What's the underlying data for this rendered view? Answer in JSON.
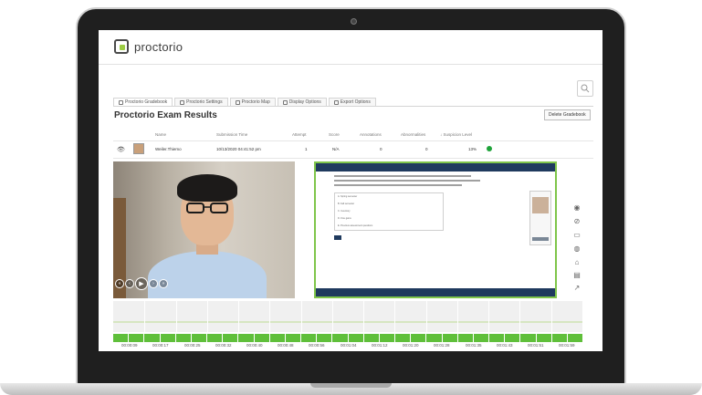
{
  "app": {
    "logo_text": "proctorio"
  },
  "tabs": [
    {
      "label": "Proctorio Gradebook",
      "icon": "gradebook-icon",
      "active": true
    },
    {
      "label": "Proctorio Settings",
      "icon": "gear-icon",
      "active": false
    },
    {
      "label": "Proctorio Map",
      "icon": "map-icon",
      "active": false
    },
    {
      "label": "Display Options",
      "icon": "display-icon",
      "active": false
    },
    {
      "label": "Export Options",
      "icon": "export-icon",
      "active": false
    }
  ],
  "page": {
    "title": "Proctorio Exam Results",
    "delete_button": "Delete Gradebook"
  },
  "table": {
    "headers": [
      "Name",
      "Submission Time",
      "Attempt",
      "Score",
      "Annotations",
      "Abnormalities",
      "Suspicion Level"
    ],
    "row": {
      "name": "Weiler.Thiemo",
      "submission_time": "10/13/2020 04:41:52 pm",
      "attempt": "1",
      "score": "N/A",
      "annotations": "0",
      "abnormalities": "0",
      "suspicion": "13%",
      "suspicion_color": "#1fa33a"
    }
  },
  "capture": {
    "options": [
      "A. Spring semester",
      "B. Fall semester",
      "C. Inventory",
      "D. Fine gains",
      "E. Previous assessment questions"
    ]
  },
  "timeline": {
    "times": [
      "00:00:09",
      "00:00:17",
      "00:00:25",
      "00:00:32",
      "00:00:40",
      "00:00:48",
      "00:00:56",
      "00:01:04",
      "00:01:12",
      "00:01:20",
      "00:01:28",
      "00:01:35",
      "00:01:43",
      "00:01:51",
      "00:01:59"
    ]
  },
  "colors": {
    "accent_green": "#5fbf3a",
    "capture_border": "#7fc54a",
    "nav_dark": "#1f3a5e"
  }
}
